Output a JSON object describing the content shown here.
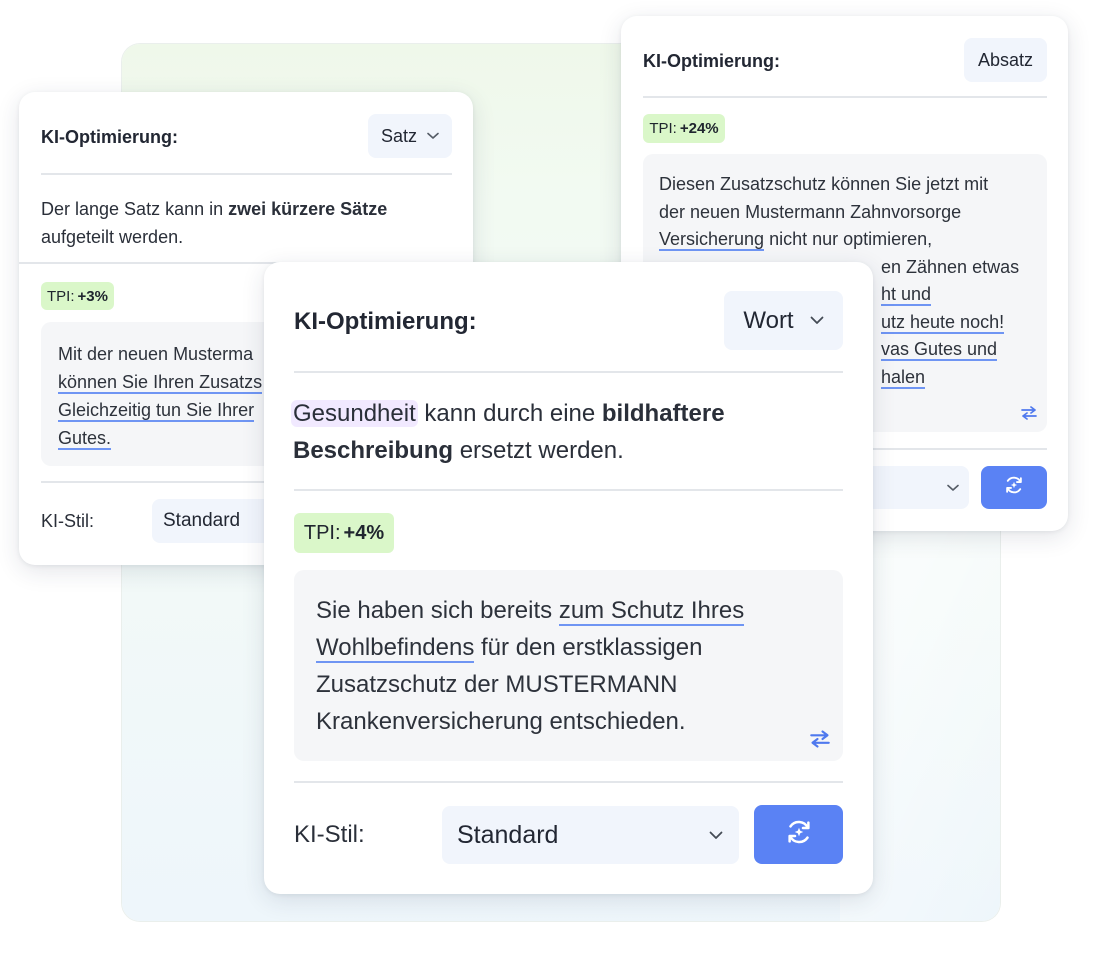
{
  "colors": {
    "accent_blue": "#5a82f4",
    "underline_blue": "#6f95f3",
    "tpi_green": "#daf7c9",
    "highlight_purple": "#f1e9ff",
    "select_bg": "#f1f5fc",
    "text_box_bg": "#f5f6f8",
    "text_dark": "#222733"
  },
  "left_card": {
    "title": "KI-Optimierung:",
    "mode_select": "Satz",
    "description_before": "Der lange Satz kann in ",
    "description_bold": "zwei kürzere Sätze",
    "description_after": "aufgeteilt werden.",
    "tpi_label": "TPI:",
    "tpi_value": "+3%",
    "text_lines": [
      "Mit der neuen Musterma",
      "können Sie Ihren Zusatzs",
      "Gleichzeitig tun Sie Ihrer",
      "Gutes."
    ],
    "style_label": "KI-Stil:",
    "style_value": "Standard"
  },
  "right_card": {
    "title": "KI-Optimierung:",
    "mode_select": "Absatz",
    "tpi_label": "TPI:",
    "tpi_value": "+24%",
    "text_lines": {
      "line1": "Diesen Zusatzschutz können Sie jetzt mit",
      "line2": "der neuen Mustermann Zahnvorsorge",
      "line3_underlined": "Versicherung",
      "line3_rest": " nicht nur optimieren,",
      "line4_rest": "en Zähnen etwas",
      "line5": "ht und",
      "line6": "utz heute noch!",
      "line7": "vas Gutes und",
      "line8": "halen"
    }
  },
  "center_card": {
    "title": "KI-Optimierung:",
    "mode_select": "Wort",
    "highlight_word": "Gesundheit",
    "description_middle": " kann durch eine ",
    "description_bold_1": "bildhaftere",
    "description_bold_2": "Beschreibung",
    "description_after": " ersetzt werden.",
    "tpi_label": "TPI:",
    "tpi_value": "+4%",
    "text": {
      "line1_start": "Sie haben sich bereits ",
      "line1_underlined": "zum Schutz Ihres",
      "line2_underlined": "Wohlbefindens",
      "line2_rest": " für den erstklassigen",
      "line3": "Zusatzschutz der MUSTERMANN",
      "line4": "Krankenversicherung entschieden."
    },
    "style_label": "KI-Stil:",
    "style_value": "Standard"
  },
  "icons": {
    "chevron": "chevron-down-icon",
    "swap": "swap-arrows-icon",
    "refresh": "refresh-sparkle-icon"
  }
}
